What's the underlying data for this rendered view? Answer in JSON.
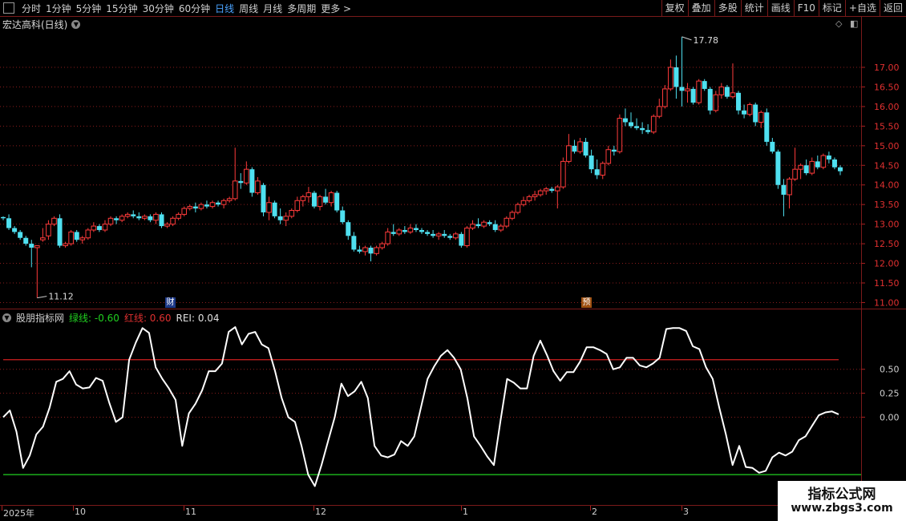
{
  "toolbar": {
    "timeframes": [
      "分时",
      "1分钟",
      "5分钟",
      "15分钟",
      "30分钟",
      "60分钟",
      "日线",
      "周线",
      "月线",
      "多周期",
      "更多 >"
    ],
    "active": "日线",
    "tools": [
      "复权",
      "叠加",
      "多股",
      "统计",
      "画线",
      "F10",
      "标记",
      "+自选",
      "返回"
    ]
  },
  "stock": {
    "title": "宏达高科(日线)"
  },
  "indicator": {
    "name": "股朋指标网",
    "green_label": "绿线: -0.60",
    "red_label": "红线: 0.60",
    "rei_label": "REI: 0.04"
  },
  "price_axis": {
    "ticks": [
      "17.00",
      "16.50",
      "16.00",
      "15.50",
      "15.00",
      "14.50",
      "14.00",
      "13.50",
      "13.00",
      "12.50",
      "12.00",
      "11.50",
      "11.00"
    ]
  },
  "rei_axis": {
    "ticks": [
      "0.50",
      "0.25",
      "0.00"
    ]
  },
  "annotations": {
    "high": "17.78",
    "low": "11.12",
    "badge_cai": "财",
    "badge_yu": "预"
  },
  "x_labels": [
    "2025年",
    "10",
    "11",
    "12",
    "1",
    "2",
    "3"
  ],
  "watermark": {
    "line1": "指标公式网",
    "line2": "www.zbgs3.com"
  },
  "colors": {
    "up": "#ff3b3b",
    "down": "#4fe0f0",
    "line": "#ffffff",
    "red_line": "#d02020",
    "green_line": "#20d020",
    "grid": "#8a1c1c"
  },
  "chart_data": [
    {
      "type": "candlestick",
      "title": "宏达高科(日线)",
      "ylim": [
        10.9,
        18.0
      ],
      "high_marker": 17.78,
      "low_marker": 11.12,
      "ohlc": [
        [
          13.18,
          13.2,
          13.1,
          13.15
        ],
        [
          13.15,
          13.25,
          12.85,
          12.9
        ],
        [
          12.9,
          12.95,
          12.75,
          12.8
        ],
        [
          12.8,
          12.85,
          12.6,
          12.65
        ],
        [
          12.65,
          12.7,
          12.45,
          12.5
        ],
        [
          12.5,
          12.6,
          11.9,
          12.4
        ],
        [
          12.4,
          12.45,
          11.12,
          12.45
        ],
        [
          12.6,
          12.9,
          12.55,
          12.65
        ],
        [
          12.7,
          13.1,
          12.6,
          13.0
        ],
        [
          13.0,
          13.2,
          12.95,
          13.15
        ],
        [
          13.15,
          13.25,
          12.4,
          12.45
        ],
        [
          12.45,
          12.55,
          12.4,
          12.5
        ],
        [
          12.5,
          12.85,
          12.45,
          12.8
        ],
        [
          12.8,
          12.85,
          12.55,
          12.6
        ],
        [
          12.6,
          12.7,
          12.5,
          12.65
        ],
        [
          12.65,
          12.9,
          12.6,
          12.85
        ],
        [
          12.85,
          13.05,
          12.8,
          12.95
        ],
        [
          12.95,
          13.0,
          12.8,
          12.85
        ],
        [
          12.85,
          13.1,
          12.8,
          13.0
        ],
        [
          13.0,
          13.2,
          12.95,
          13.15
        ],
        [
          13.15,
          13.2,
          13.0,
          13.1
        ],
        [
          13.1,
          13.25,
          13.05,
          13.2
        ],
        [
          13.2,
          13.3,
          13.15,
          13.25
        ],
        [
          13.25,
          13.35,
          13.15,
          13.2
        ],
        [
          13.2,
          13.3,
          13.1,
          13.15
        ],
        [
          13.15,
          13.25,
          13.1,
          13.2
        ],
        [
          13.2,
          13.25,
          13.05,
          13.1
        ],
        [
          13.1,
          13.3,
          13.0,
          13.25
        ],
        [
          13.25,
          13.3,
          12.9,
          12.95
        ],
        [
          12.95,
          13.05,
          12.9,
          13.0
        ],
        [
          13.0,
          13.2,
          12.95,
          13.15
        ],
        [
          13.15,
          13.3,
          13.1,
          13.25
        ],
        [
          13.25,
          13.45,
          13.2,
          13.4
        ],
        [
          13.4,
          13.5,
          13.35,
          13.45
        ],
        [
          13.45,
          13.55,
          13.3,
          13.4
        ],
        [
          13.4,
          13.55,
          13.35,
          13.5
        ],
        [
          13.5,
          13.6,
          13.4,
          13.45
        ],
        [
          13.45,
          13.6,
          13.4,
          13.55
        ],
        [
          13.55,
          13.6,
          13.45,
          13.5
        ],
        [
          13.5,
          13.65,
          13.4,
          13.6
        ],
        [
          13.6,
          13.7,
          13.55,
          13.65
        ],
        [
          13.65,
          14.95,
          13.6,
          14.1
        ],
        [
          14.1,
          14.3,
          13.9,
          14.05
        ],
        [
          14.05,
          14.6,
          14.0,
          14.4
        ],
        [
          14.4,
          14.45,
          13.7,
          13.8
        ],
        [
          13.8,
          14.2,
          13.75,
          14.1
        ],
        [
          14.0,
          14.05,
          13.2,
          13.3
        ],
        [
          13.3,
          13.7,
          13.1,
          13.55
        ],
        [
          13.55,
          13.6,
          13.15,
          13.2
        ],
        [
          13.2,
          13.4,
          13.0,
          13.1
        ],
        [
          13.1,
          13.3,
          12.95,
          13.2
        ],
        [
          13.2,
          13.4,
          13.15,
          13.35
        ],
        [
          13.35,
          13.7,
          13.3,
          13.6
        ],
        [
          13.6,
          13.75,
          13.45,
          13.7
        ],
        [
          13.7,
          13.95,
          13.55,
          13.8
        ],
        [
          13.8,
          13.85,
          13.4,
          13.45
        ],
        [
          13.45,
          13.75,
          13.35,
          13.7
        ],
        [
          13.7,
          13.9,
          13.5,
          13.55
        ],
        [
          13.55,
          13.85,
          13.45,
          13.8
        ],
        [
          13.8,
          13.85,
          13.3,
          13.35
        ],
        [
          13.35,
          13.45,
          13.0,
          13.05
        ],
        [
          13.05,
          13.1,
          12.6,
          12.7
        ],
        [
          12.7,
          12.8,
          12.3,
          12.35
        ],
        [
          12.35,
          12.45,
          12.25,
          12.3
        ],
        [
          12.3,
          12.45,
          12.2,
          12.4
        ],
        [
          12.4,
          12.45,
          12.05,
          12.25
        ],
        [
          12.25,
          12.45,
          12.2,
          12.4
        ],
        [
          12.4,
          12.55,
          12.35,
          12.5
        ],
        [
          12.5,
          12.9,
          12.45,
          12.8
        ],
        [
          12.8,
          13.0,
          12.7,
          12.75
        ],
        [
          12.75,
          12.9,
          12.7,
          12.85
        ],
        [
          12.85,
          12.95,
          12.75,
          12.8
        ],
        [
          12.8,
          13.0,
          12.75,
          12.9
        ],
        [
          12.9,
          13.0,
          12.8,
          12.85
        ],
        [
          12.85,
          12.9,
          12.75,
          12.8
        ],
        [
          12.8,
          12.85,
          12.7,
          12.75
        ],
        [
          12.75,
          12.85,
          12.65,
          12.7
        ],
        [
          12.7,
          12.8,
          12.6,
          12.75
        ],
        [
          12.75,
          12.85,
          12.65,
          12.7
        ],
        [
          12.7,
          12.75,
          12.6,
          12.65
        ],
        [
          12.65,
          12.8,
          12.6,
          12.75
        ],
        [
          12.75,
          12.8,
          12.4,
          12.45
        ],
        [
          12.45,
          12.95,
          12.4,
          12.9
        ],
        [
          12.9,
          13.1,
          12.85,
          13.0
        ],
        [
          13.0,
          13.15,
          12.9,
          12.95
        ],
        [
          12.95,
          13.1,
          12.9,
          13.05
        ],
        [
          13.05,
          13.1,
          12.95,
          13.0
        ],
        [
          13.0,
          13.1,
          12.8,
          12.85
        ],
        [
          12.85,
          13.0,
          12.8,
          12.95
        ],
        [
          12.95,
          13.2,
          12.9,
          13.15
        ],
        [
          13.15,
          13.35,
          13.1,
          13.3
        ],
        [
          13.3,
          13.55,
          13.25,
          13.5
        ],
        [
          13.5,
          13.7,
          13.45,
          13.6
        ],
        [
          13.6,
          13.75,
          13.55,
          13.7
        ],
        [
          13.7,
          13.85,
          13.6,
          13.75
        ],
        [
          13.75,
          13.9,
          13.7,
          13.85
        ],
        [
          13.85,
          13.95,
          13.75,
          13.9
        ],
        [
          13.9,
          13.95,
          13.8,
          13.85
        ],
        [
          13.85,
          14.0,
          13.4,
          13.95
        ],
        [
          13.95,
          14.7,
          13.9,
          14.6
        ],
        [
          14.6,
          15.3,
          14.55,
          15.0
        ],
        [
          15.0,
          15.15,
          14.8,
          14.85
        ],
        [
          14.85,
          15.2,
          14.8,
          15.1
        ],
        [
          15.1,
          15.2,
          14.7,
          14.75
        ],
        [
          14.75,
          14.9,
          14.3,
          14.4
        ],
        [
          14.4,
          14.65,
          14.15,
          14.25
        ],
        [
          14.25,
          14.6,
          14.15,
          14.55
        ],
        [
          14.55,
          15.0,
          14.5,
          14.9
        ],
        [
          14.9,
          15.0,
          14.75,
          14.85
        ],
        [
          14.85,
          15.8,
          14.8,
          15.7
        ],
        [
          15.7,
          15.95,
          15.5,
          15.6
        ],
        [
          15.6,
          15.85,
          15.45,
          15.5
        ],
        [
          15.5,
          15.7,
          15.4,
          15.45
        ],
        [
          15.45,
          15.6,
          15.3,
          15.4
        ],
        [
          15.4,
          15.55,
          15.3,
          15.35
        ],
        [
          15.35,
          15.8,
          15.3,
          15.75
        ],
        [
          15.75,
          16.2,
          15.7,
          16.0
        ],
        [
          16.0,
          16.55,
          15.95,
          16.45
        ],
        [
          16.45,
          17.2,
          16.4,
          17.0
        ],
        [
          17.0,
          17.3,
          16.2,
          16.5
        ],
        [
          16.5,
          17.78,
          16.0,
          16.4
        ],
        [
          16.4,
          16.6,
          16.1,
          16.45
        ],
        [
          16.45,
          16.5,
          16.05,
          16.1
        ],
        [
          16.1,
          16.7,
          16.05,
          16.65
        ],
        [
          16.65,
          16.7,
          16.4,
          16.45
        ],
        [
          16.45,
          16.5,
          15.8,
          15.9
        ],
        [
          15.9,
          16.4,
          15.85,
          16.3
        ],
        [
          16.3,
          16.6,
          16.2,
          16.5
        ],
        [
          16.5,
          16.55,
          16.2,
          16.25
        ],
        [
          16.25,
          17.1,
          16.2,
          16.35
        ],
        [
          16.35,
          16.4,
          15.8,
          15.9
        ],
        [
          15.9,
          16.05,
          15.7,
          15.8
        ],
        [
          15.8,
          16.1,
          15.75,
          16.05
        ],
        [
          16.05,
          16.1,
          15.5,
          15.6
        ],
        [
          15.6,
          15.9,
          15.45,
          15.85
        ],
        [
          15.85,
          15.95,
          15.0,
          15.1
        ],
        [
          15.1,
          15.2,
          14.8,
          14.85
        ],
        [
          14.85,
          14.9,
          13.9,
          14.0
        ],
        [
          14.0,
          14.15,
          13.2,
          13.75
        ],
        [
          13.75,
          14.2,
          13.4,
          14.15
        ],
        [
          14.15,
          14.95,
          14.1,
          14.4
        ],
        [
          14.4,
          14.55,
          14.15,
          14.5
        ],
        [
          14.5,
          14.65,
          14.25,
          14.3
        ],
        [
          14.3,
          14.7,
          14.25,
          14.6
        ],
        [
          14.6,
          14.75,
          14.4,
          14.45
        ],
        [
          14.45,
          14.8,
          14.4,
          14.75
        ],
        [
          14.75,
          14.85,
          14.55,
          14.65
        ],
        [
          14.65,
          14.7,
          14.4,
          14.45
        ],
        [
          14.45,
          14.5,
          14.25,
          14.35
        ]
      ]
    },
    {
      "type": "line",
      "title": "股朋指标网",
      "series": [
        {
          "name": "REI",
          "values": [
            0.0,
            0.07,
            -0.15,
            -0.53,
            -0.4,
            -0.18,
            -0.1,
            0.1,
            0.37,
            0.4,
            0.48,
            0.34,
            0.3,
            0.31,
            0.41,
            0.38,
            0.15,
            -0.05,
            0.0,
            0.6,
            0.78,
            0.93,
            0.88,
            0.52,
            0.4,
            0.3,
            0.18,
            -0.3,
            0.04,
            0.14,
            0.28,
            0.48,
            0.48,
            0.56,
            0.89,
            0.94,
            0.76,
            0.87,
            0.89,
            0.76,
            0.72,
            0.48,
            0.2,
            0.0,
            -0.05,
            -0.3,
            -0.6,
            -0.72,
            -0.5,
            -0.25,
            0.0,
            0.35,
            0.22,
            0.27,
            0.37,
            0.2,
            -0.3,
            -0.4,
            -0.42,
            -0.39,
            -0.25,
            -0.3,
            -0.2,
            0.1,
            0.4,
            0.53,
            0.64,
            0.7,
            0.62,
            0.5,
            0.2,
            -0.2,
            -0.3,
            -0.41,
            -0.5,
            -0.04,
            0.4,
            0.36,
            0.3,
            0.3,
            0.64,
            0.8,
            0.65,
            0.48,
            0.38,
            0.47,
            0.47,
            0.58,
            0.73,
            0.73,
            0.7,
            0.66,
            0.5,
            0.52,
            0.62,
            0.62,
            0.54,
            0.52,
            0.56,
            0.62,
            0.92,
            0.93,
            0.93,
            0.9,
            0.74,
            0.71,
            0.52,
            0.4,
            0.1,
            -0.18,
            -0.5,
            -0.3,
            -0.52,
            -0.53,
            -0.58,
            -0.56,
            -0.42,
            -0.37,
            -0.4,
            -0.36,
            -0.24,
            -0.2,
            -0.09,
            0.02,
            0.05,
            0.06,
            0.03
          ]
        },
        {
          "name": "红线",
          "values": [
            0.6
          ]
        },
        {
          "name": "绿线",
          "values": [
            -0.6
          ]
        }
      ]
    }
  ]
}
